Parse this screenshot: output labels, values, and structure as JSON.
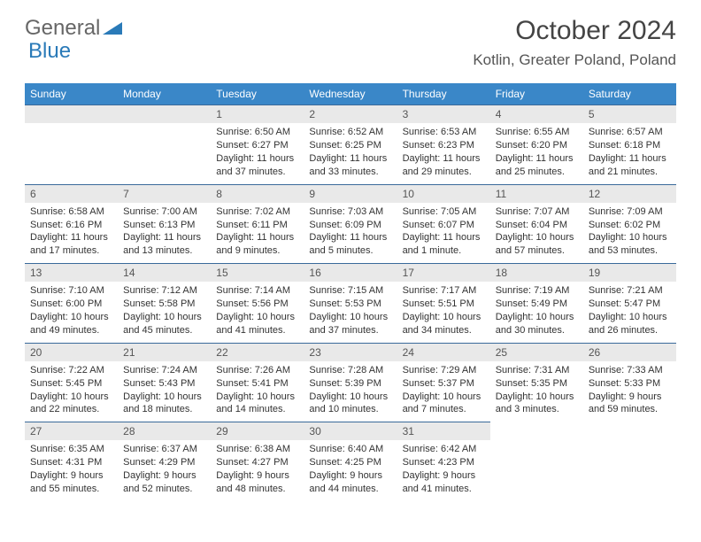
{
  "brand": {
    "part1": "General",
    "part2": "Blue"
  },
  "title": "October 2024",
  "location": "Kotlin, Greater Poland, Poland",
  "dow": [
    "Sunday",
    "Monday",
    "Tuesday",
    "Wednesday",
    "Thursday",
    "Friday",
    "Saturday"
  ],
  "weeks": [
    [
      null,
      null,
      {
        "n": "1",
        "sr": "Sunrise: 6:50 AM",
        "ss": "Sunset: 6:27 PM",
        "dl": "Daylight: 11 hours and 37 minutes."
      },
      {
        "n": "2",
        "sr": "Sunrise: 6:52 AM",
        "ss": "Sunset: 6:25 PM",
        "dl": "Daylight: 11 hours and 33 minutes."
      },
      {
        "n": "3",
        "sr": "Sunrise: 6:53 AM",
        "ss": "Sunset: 6:23 PM",
        "dl": "Daylight: 11 hours and 29 minutes."
      },
      {
        "n": "4",
        "sr": "Sunrise: 6:55 AM",
        "ss": "Sunset: 6:20 PM",
        "dl": "Daylight: 11 hours and 25 minutes."
      },
      {
        "n": "5",
        "sr": "Sunrise: 6:57 AM",
        "ss": "Sunset: 6:18 PM",
        "dl": "Daylight: 11 hours and 21 minutes."
      }
    ],
    [
      {
        "n": "6",
        "sr": "Sunrise: 6:58 AM",
        "ss": "Sunset: 6:16 PM",
        "dl": "Daylight: 11 hours and 17 minutes."
      },
      {
        "n": "7",
        "sr": "Sunrise: 7:00 AM",
        "ss": "Sunset: 6:13 PM",
        "dl": "Daylight: 11 hours and 13 minutes."
      },
      {
        "n": "8",
        "sr": "Sunrise: 7:02 AM",
        "ss": "Sunset: 6:11 PM",
        "dl": "Daylight: 11 hours and 9 minutes."
      },
      {
        "n": "9",
        "sr": "Sunrise: 7:03 AM",
        "ss": "Sunset: 6:09 PM",
        "dl": "Daylight: 11 hours and 5 minutes."
      },
      {
        "n": "10",
        "sr": "Sunrise: 7:05 AM",
        "ss": "Sunset: 6:07 PM",
        "dl": "Daylight: 11 hours and 1 minute."
      },
      {
        "n": "11",
        "sr": "Sunrise: 7:07 AM",
        "ss": "Sunset: 6:04 PM",
        "dl": "Daylight: 10 hours and 57 minutes."
      },
      {
        "n": "12",
        "sr": "Sunrise: 7:09 AM",
        "ss": "Sunset: 6:02 PM",
        "dl": "Daylight: 10 hours and 53 minutes."
      }
    ],
    [
      {
        "n": "13",
        "sr": "Sunrise: 7:10 AM",
        "ss": "Sunset: 6:00 PM",
        "dl": "Daylight: 10 hours and 49 minutes."
      },
      {
        "n": "14",
        "sr": "Sunrise: 7:12 AM",
        "ss": "Sunset: 5:58 PM",
        "dl": "Daylight: 10 hours and 45 minutes."
      },
      {
        "n": "15",
        "sr": "Sunrise: 7:14 AM",
        "ss": "Sunset: 5:56 PM",
        "dl": "Daylight: 10 hours and 41 minutes."
      },
      {
        "n": "16",
        "sr": "Sunrise: 7:15 AM",
        "ss": "Sunset: 5:53 PM",
        "dl": "Daylight: 10 hours and 37 minutes."
      },
      {
        "n": "17",
        "sr": "Sunrise: 7:17 AM",
        "ss": "Sunset: 5:51 PM",
        "dl": "Daylight: 10 hours and 34 minutes."
      },
      {
        "n": "18",
        "sr": "Sunrise: 7:19 AM",
        "ss": "Sunset: 5:49 PM",
        "dl": "Daylight: 10 hours and 30 minutes."
      },
      {
        "n": "19",
        "sr": "Sunrise: 7:21 AM",
        "ss": "Sunset: 5:47 PM",
        "dl": "Daylight: 10 hours and 26 minutes."
      }
    ],
    [
      {
        "n": "20",
        "sr": "Sunrise: 7:22 AM",
        "ss": "Sunset: 5:45 PM",
        "dl": "Daylight: 10 hours and 22 minutes."
      },
      {
        "n": "21",
        "sr": "Sunrise: 7:24 AM",
        "ss": "Sunset: 5:43 PM",
        "dl": "Daylight: 10 hours and 18 minutes."
      },
      {
        "n": "22",
        "sr": "Sunrise: 7:26 AM",
        "ss": "Sunset: 5:41 PM",
        "dl": "Daylight: 10 hours and 14 minutes."
      },
      {
        "n": "23",
        "sr": "Sunrise: 7:28 AM",
        "ss": "Sunset: 5:39 PM",
        "dl": "Daylight: 10 hours and 10 minutes."
      },
      {
        "n": "24",
        "sr": "Sunrise: 7:29 AM",
        "ss": "Sunset: 5:37 PM",
        "dl": "Daylight: 10 hours and 7 minutes."
      },
      {
        "n": "25",
        "sr": "Sunrise: 7:31 AM",
        "ss": "Sunset: 5:35 PM",
        "dl": "Daylight: 10 hours and 3 minutes."
      },
      {
        "n": "26",
        "sr": "Sunrise: 7:33 AM",
        "ss": "Sunset: 5:33 PM",
        "dl": "Daylight: 9 hours and 59 minutes."
      }
    ],
    [
      {
        "n": "27",
        "sr": "Sunrise: 6:35 AM",
        "ss": "Sunset: 4:31 PM",
        "dl": "Daylight: 9 hours and 55 minutes."
      },
      {
        "n": "28",
        "sr": "Sunrise: 6:37 AM",
        "ss": "Sunset: 4:29 PM",
        "dl": "Daylight: 9 hours and 52 minutes."
      },
      {
        "n": "29",
        "sr": "Sunrise: 6:38 AM",
        "ss": "Sunset: 4:27 PM",
        "dl": "Daylight: 9 hours and 48 minutes."
      },
      {
        "n": "30",
        "sr": "Sunrise: 6:40 AM",
        "ss": "Sunset: 4:25 PM",
        "dl": "Daylight: 9 hours and 44 minutes."
      },
      {
        "n": "31",
        "sr": "Sunrise: 6:42 AM",
        "ss": "Sunset: 4:23 PM",
        "dl": "Daylight: 9 hours and 41 minutes."
      },
      null,
      null
    ]
  ]
}
